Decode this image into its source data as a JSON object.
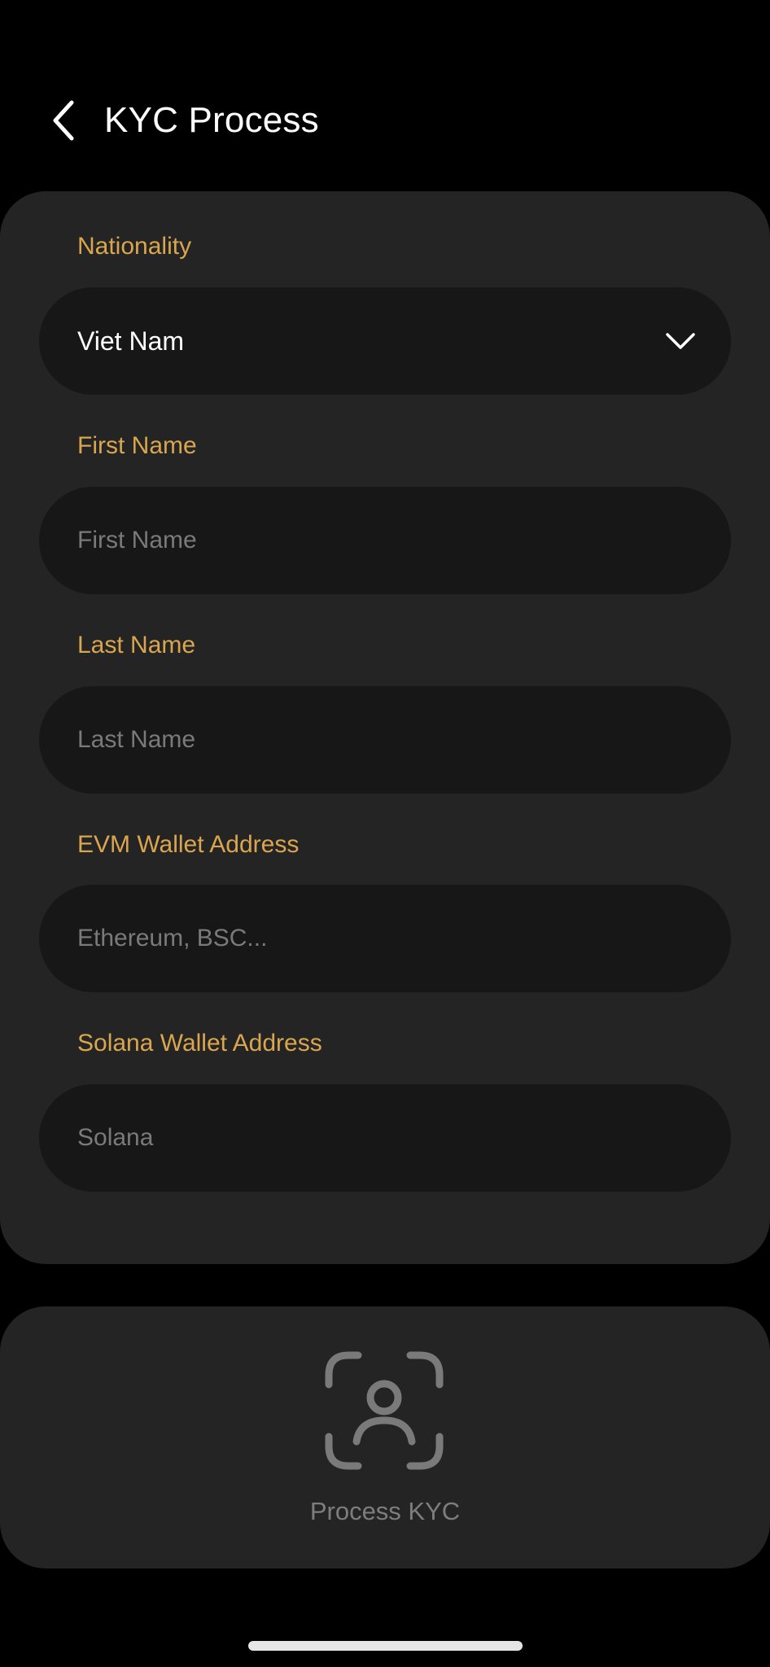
{
  "header": {
    "title": "KYC Process",
    "back_icon": "chevron-left-icon"
  },
  "form": {
    "nationality": {
      "label": "Nationality",
      "value": "Viet Nam",
      "icon": "chevron-down-icon"
    },
    "first_name": {
      "label": "First Name",
      "placeholder": "First Name",
      "value": ""
    },
    "last_name": {
      "label": "Last Name",
      "placeholder": "Last Name",
      "value": ""
    },
    "evm_wallet": {
      "label": "EVM Wallet Address",
      "placeholder": "Ethereum, BSC...",
      "value": ""
    },
    "solana_wallet": {
      "label": "Solana Wallet Address",
      "placeholder": "Solana",
      "value": ""
    }
  },
  "kyc_action": {
    "label": "Process KYC",
    "icon": "face-scan-icon"
  },
  "colors": {
    "background": "#000000",
    "card": "#242424",
    "field": "#171717",
    "label_accent": "#d9a64f",
    "placeholder": "#7a7a7a",
    "text": "#ffffff"
  }
}
